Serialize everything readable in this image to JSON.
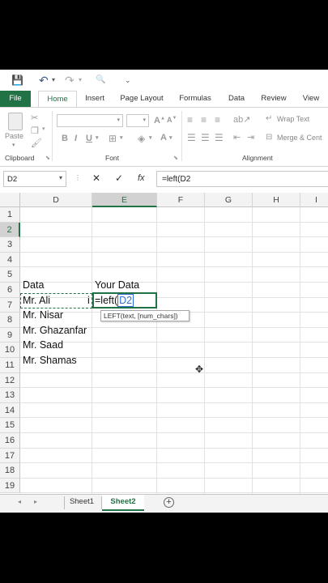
{
  "qat": {
    "save": "💾",
    "undo": "↶",
    "redo": "↷",
    "preview": "🔍",
    "more": "⌄"
  },
  "tabs": [
    "File",
    "Home",
    "Insert",
    "Page Layout",
    "Formulas",
    "Data",
    "Review",
    "View"
  ],
  "ribbon": {
    "paste_label": "Paste",
    "groups": {
      "clipboard": "Clipboard",
      "font": "Font",
      "alignment": "Alignment"
    },
    "wrap_text": "Wrap Text",
    "merge_center": "Merge & Cent"
  },
  "formula_bar": {
    "name_box": "D2",
    "cancel": "✕",
    "enter": "✓",
    "fx": "fx",
    "formula": "=left(D2"
  },
  "columns": [
    "D",
    "E",
    "F",
    "G",
    "H",
    "I"
  ],
  "rows": [
    "1",
    "2",
    "3",
    "4",
    "5",
    "6",
    "7",
    "8",
    "9",
    "10",
    "11",
    "12",
    "13",
    "14",
    "15",
    "16",
    "17",
    "18",
    "19"
  ],
  "cells": {
    "D1": "Data",
    "E1": "Your Data",
    "D2": "Mr. Ali",
    "D3": "Mr. Nisar",
    "D4": "Mr. Ghazanfar",
    "D5": "Mr. Saad",
    "D6": "Mr. Shamas"
  },
  "edit": {
    "prefix": "=left(",
    "ref": "D2",
    "d2_overflow": "i"
  },
  "tooltip": "LEFT(text, [num_chars])",
  "sheets": {
    "sheet1": "Sheet1",
    "sheet2": "Sheet2",
    "add": "+"
  },
  "colors": {
    "accent": "#217346",
    "ref_blue": "#2f6fd6"
  }
}
